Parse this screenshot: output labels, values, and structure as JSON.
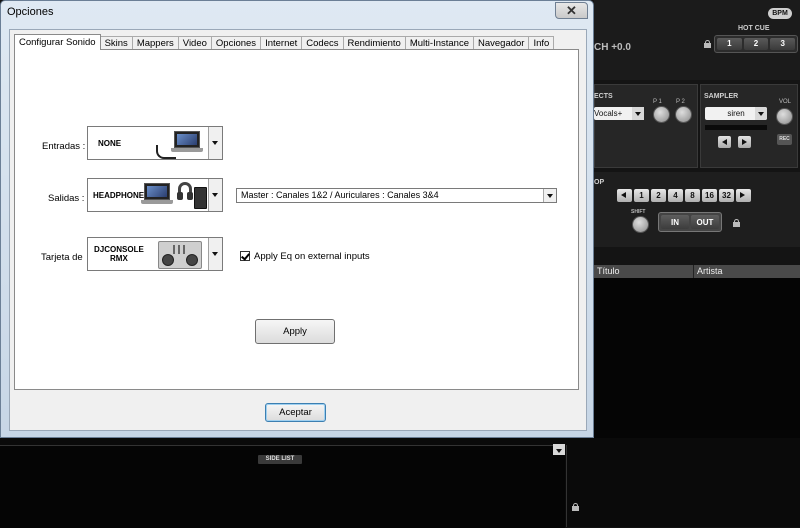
{
  "window": {
    "title": "Opciones",
    "close_glyph": "✕"
  },
  "tabs": [
    {
      "label": "Configurar Sonido",
      "active": true
    },
    {
      "label": "Skins"
    },
    {
      "label": "Mappers"
    },
    {
      "label": "Video"
    },
    {
      "label": "Opciones"
    },
    {
      "label": "Internet"
    },
    {
      "label": "Codecs"
    },
    {
      "label": "Rendimiento"
    },
    {
      "label": "Multi-Instance"
    },
    {
      "label": "Navegador"
    },
    {
      "label": "Info"
    }
  ],
  "sound": {
    "inputs": {
      "label": "Entradas :",
      "device": "NONE"
    },
    "outputs": {
      "label": "Salidas :",
      "device": "HEADPHONES",
      "routing": "Master : Canales 1&2 / Auriculares : Canales 3&4"
    },
    "card": {
      "label": "Tarjeta de",
      "device_line1": "DJCONSOLE",
      "device_line2": "RMX"
    },
    "eq_checkbox": {
      "label": "Apply Eq on external inputs",
      "checked": true
    },
    "apply_label": "Apply"
  },
  "accept_label": "Aceptar",
  "background_app": {
    "bpm_badge": "BPM",
    "pitch_text": "CH +0.0",
    "hot_cue": {
      "label": "HOT CUE",
      "buttons": [
        "1",
        "2",
        "3"
      ]
    },
    "effects": {
      "label": "ECTS",
      "selected": "Vocals+",
      "p1": "P 1",
      "p2": "P 2"
    },
    "sampler": {
      "label": "SAMPLER",
      "selected": "siren",
      "vol": "VOL",
      "rec": "REC"
    },
    "loop": {
      "label": "OP",
      "sizes": [
        "1",
        "2",
        "4",
        "8",
        "16",
        "32"
      ],
      "shift": "SHIFT",
      "in": "IN",
      "out": "OUT"
    },
    "list_columns": [
      "Título",
      "Artista"
    ],
    "side_list": "SIDE LIST"
  }
}
